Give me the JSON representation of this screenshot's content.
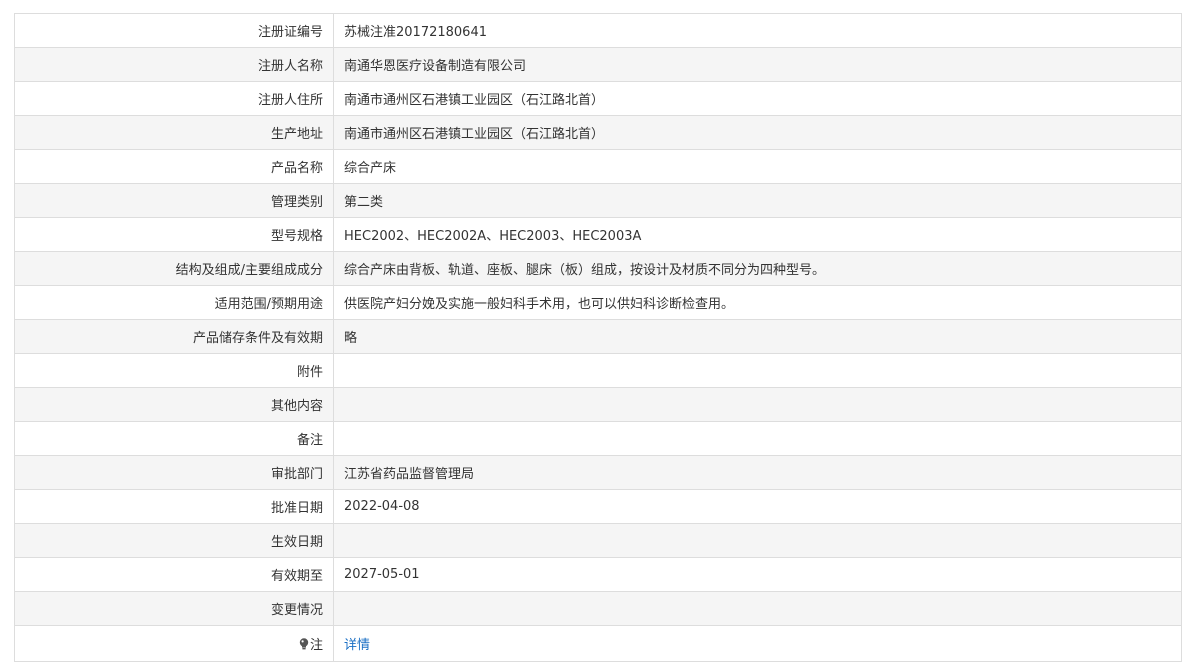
{
  "rows": [
    {
      "label": "注册证编号",
      "value": "苏械注准20172180641"
    },
    {
      "label": "注册人名称",
      "value": "南通华恩医疗设备制造有限公司"
    },
    {
      "label": "注册人住所",
      "value": "南通市通州区石港镇工业园区（石江路北首）"
    },
    {
      "label": "生产地址",
      "value": "南通市通州区石港镇工业园区（石江路北首）"
    },
    {
      "label": "产品名称",
      "value": "综合产床"
    },
    {
      "label": "管理类别",
      "value": "第二类"
    },
    {
      "label": "型号规格",
      "value": "HEC2002、HEC2002A、HEC2003、HEC2003A"
    },
    {
      "label": "结构及组成/主要组成成分",
      "value": "综合产床由背板、轨道、座板、腿床（板）组成，按设计及材质不同分为四种型号。"
    },
    {
      "label": "适用范围/预期用途",
      "value": "供医院产妇分娩及实施一般妇科手术用，也可以供妇科诊断检查用。"
    },
    {
      "label": "产品储存条件及有效期",
      "value": "略"
    },
    {
      "label": "附件",
      "value": ""
    },
    {
      "label": "其他内容",
      "value": ""
    },
    {
      "label": "备注",
      "value": ""
    },
    {
      "label": "审批部门",
      "value": "江苏省药品监督管理局"
    },
    {
      "label": "批准日期",
      "value": "2022-04-08"
    },
    {
      "label": "生效日期",
      "value": ""
    },
    {
      "label": "有效期至",
      "value": "2027-05-01"
    },
    {
      "label": "变更情况",
      "value": ""
    }
  ],
  "note_row": {
    "label": "注",
    "icon": "lightbulb-icon",
    "link_text": "详情",
    "link_color": "#1a6fc4"
  }
}
